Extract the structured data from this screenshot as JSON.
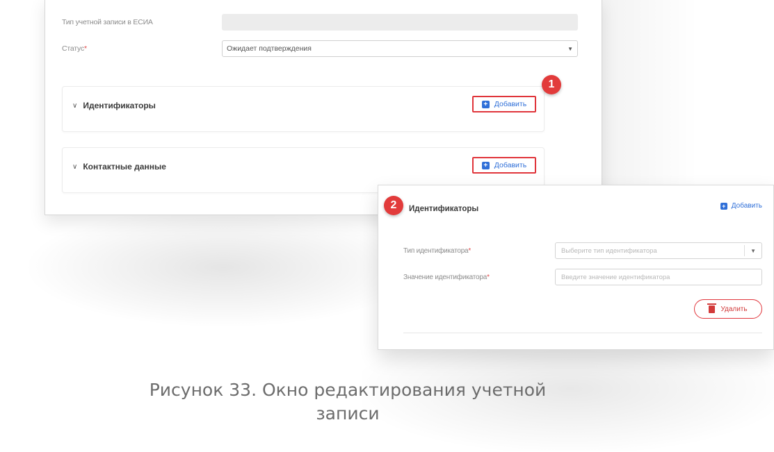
{
  "form": {
    "esia_type_label": "Тип учетной записи в ЕСИА",
    "status_label": "Статус",
    "status_value": "Ожидает подтверждения",
    "required_mark": "*"
  },
  "sections": {
    "identifiers_title": "Идентификаторы",
    "contacts_title": "Контактные данные",
    "add_label": "Добавить"
  },
  "badges": {
    "first": "1",
    "second": "2"
  },
  "zoom_panel": {
    "title": "Идентификаторы",
    "add_label": "Добавить",
    "id_type_label": "Тип идентификатора",
    "id_type_placeholder": "Выберите тип идентификатора",
    "id_value_label": "Значение идентификатора",
    "id_value_placeholder": "Введите значение идентификатора",
    "delete_label": "Удалить",
    "required_mark": "*"
  },
  "caption": {
    "line1": "Рисунок 33. Окно редактирования учетной",
    "line2": "записи"
  },
  "icons": {
    "chevron": "chevron-down-icon",
    "add": "plus-square-icon",
    "select": "caret-down-icon",
    "delete": "trash-icon"
  },
  "colors": {
    "accent_blue": "#2f6fd8",
    "highlight_red": "#e0343a",
    "badge_red": "#e23b3b"
  }
}
